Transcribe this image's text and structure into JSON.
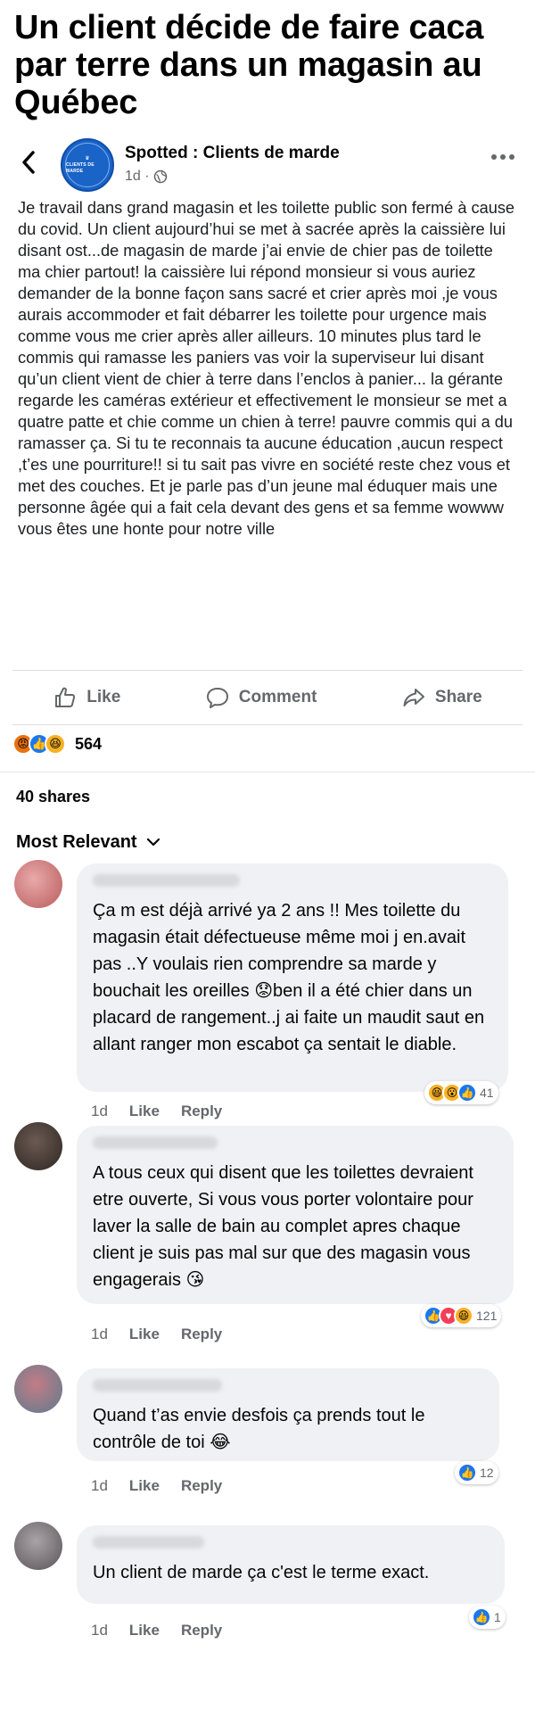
{
  "headline": "Un client décide de faire caca par terre dans un magasin au Québec",
  "post": {
    "page_name": "Spotted : Clients de marde",
    "avatar_logo_text": "CLIENTS DE MARDE",
    "time": "1d ·",
    "body": "Je travail dans grand magasin et les toilette public son fermé à cause du covid. Un client aujourd’hui se met à sacrée après la caissière lui disant ost...de magasin de marde j’ai envie de chier pas de toilette ma chier partout! la caissière lui répond monsieur si vous auriez demander de la bonne façon sans sacré et crier après moi ,je vous aurais accommoder et fait débarrer les toilette pour urgence mais comme vous me crier après aller ailleurs. 10 minutes plus tard le commis qui ramasse les paniers vas voir la superviseur lui disant qu’un client vient de chier à terre dans l’enclos à panier... la gérante regarde les caméras extérieur et effectivement le monsieur se met a quatre patte et chie comme un chien à terre! pauvre commis qui a du ramasser ça. Si tu te reconnais ta aucune éducation ,aucun respect ,t’es une pourriture!!  si tu sait pas vivre en société reste chez vous et met des couches.  Et je parle pas d’un jeune mal éduquer mais une personne âgée qui a fait cela devant des gens et sa femme wowww vous êtes une honte pour notre ville"
  },
  "actions": {
    "like": "Like",
    "comment": "Comment",
    "share": "Share"
  },
  "reactions": {
    "count": "564",
    "icons": [
      "angry",
      "like",
      "haha"
    ]
  },
  "shares_text": "40 shares",
  "sort_label": "Most Relevant",
  "comment_actions": {
    "time": "1d",
    "like": "Like",
    "reply": "Reply"
  },
  "comments": [
    {
      "text": "Ça m est déjà arrivé ya 2 ans !! Mes toilette du magasin était défectueuse même moi j en.avait pas ..Y voulais rien comprendre sa marde y bouchait les oreilles 😟ben il a été chier dans un placard de rangement..j ai faite un maudit saut en allant ranger mon escabot ça sentait le diable.",
      "reaction_count": "41",
      "reaction_icons": [
        "haha",
        "wow",
        "like"
      ]
    },
    {
      "text": "A tous ceux qui disent que les toilettes devraient etre ouverte, Si vous vous porter volontaire pour laver la salle de bain au complet apres chaque client je suis pas mal sur que des magasin vous engagerais 😘",
      "reaction_count": "121",
      "reaction_icons": [
        "like",
        "love",
        "haha"
      ]
    },
    {
      "text": "Quand t’as envie desfois ça prends tout le contrôle de toi 😂",
      "reaction_count": "12",
      "reaction_icons": [
        "like"
      ]
    },
    {
      "text": "Un client de marde ça c'est le terme exact.",
      "reaction_count": "1",
      "reaction_icons": [
        "like"
      ]
    }
  ],
  "colors": {
    "like_blue": "#1877f2",
    "love_red": "#f33e58",
    "haha_yellow": "#f7b125",
    "angry_orange": "#e9710f",
    "muted_text": "#65676b",
    "bubble_bg": "#eff1f4"
  }
}
